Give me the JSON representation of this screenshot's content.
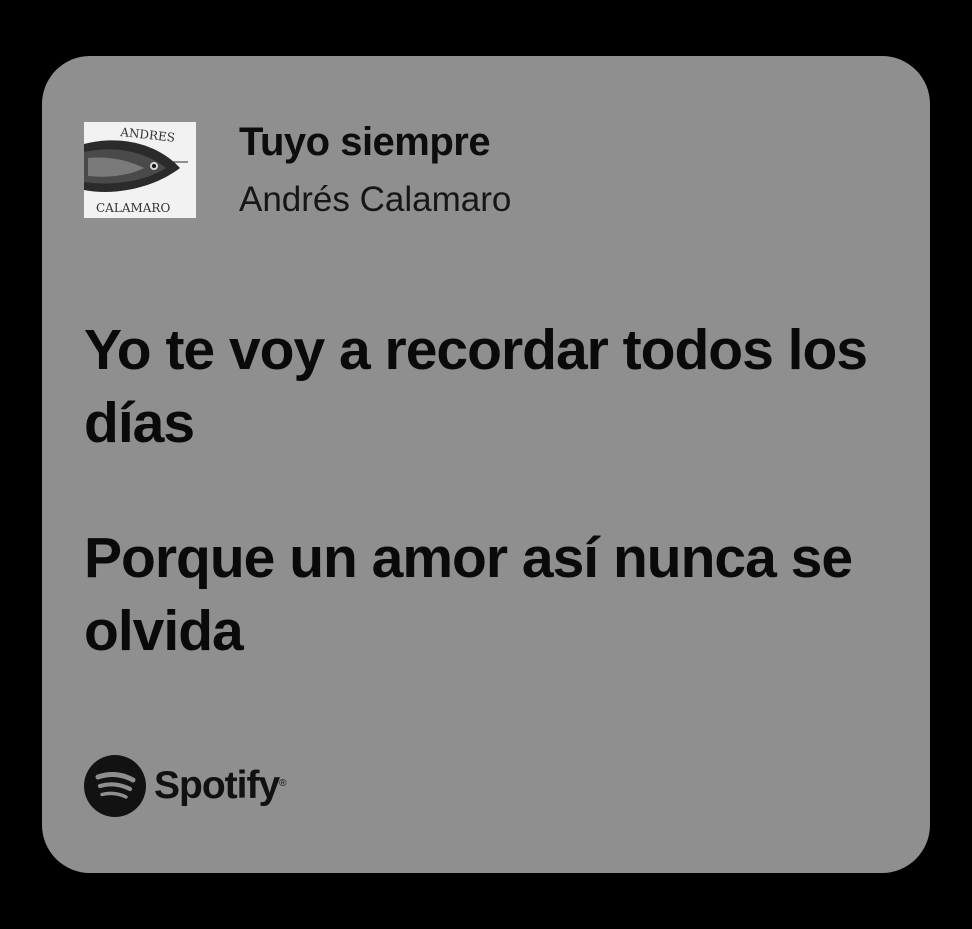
{
  "card": {
    "background": "#8f8f8f",
    "track_title": "Tuyo siempre",
    "artist": "Andrés Calamaro",
    "album_art": {
      "icon": "album-cover-fish",
      "text_top": "ANDRES",
      "text_bottom": "CALAMARO"
    },
    "lyrics": [
      "Yo te voy a recordar todos los días",
      "Porque un amor así nunca se olvida"
    ],
    "brand": {
      "name": "Spotify",
      "icon": "spotify-logo-icon",
      "registered_mark": "®"
    }
  },
  "colors": {
    "page_background": "#000000",
    "text": "#0d0d0d"
  }
}
